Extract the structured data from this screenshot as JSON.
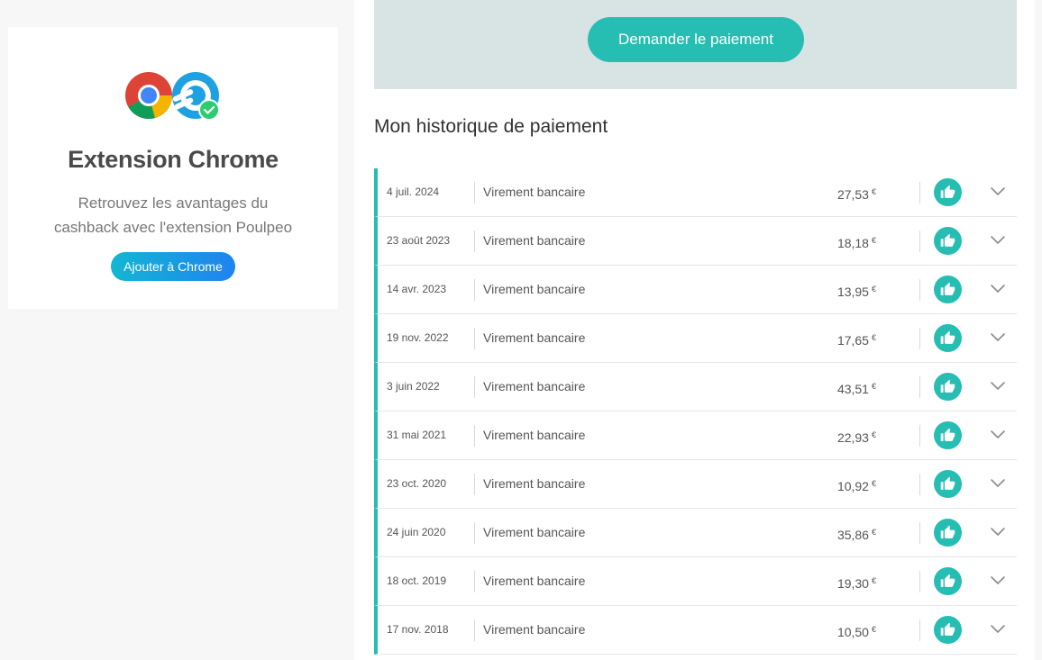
{
  "extension": {
    "title": "Extension Chrome",
    "description_line1": "Retrouvez les avantages du",
    "description_line2": "cashback avec l'extension Poulpeo",
    "button_label": "Ajouter à Chrome"
  },
  "payment": {
    "request_button_label": "Demander le paiement"
  },
  "history": {
    "title": "Mon historique de paiement",
    "currency": "€",
    "rows": [
      {
        "date": "4 juil. 2024",
        "method": "Virement bancaire",
        "amount": "27,53"
      },
      {
        "date": "23 août 2023",
        "method": "Virement bancaire",
        "amount": "18,18"
      },
      {
        "date": "14 avr. 2023",
        "method": "Virement bancaire",
        "amount": "13,95"
      },
      {
        "date": "19 nov. 2022",
        "method": "Virement bancaire",
        "amount": "17,65"
      },
      {
        "date": "3 juin 2022",
        "method": "Virement bancaire",
        "amount": "43,51"
      },
      {
        "date": "31 mai 2021",
        "method": "Virement bancaire",
        "amount": "22,93"
      },
      {
        "date": "23 oct. 2020",
        "method": "Virement bancaire",
        "amount": "10,92"
      },
      {
        "date": "24 juin 2020",
        "method": "Virement bancaire",
        "amount": "35,86"
      },
      {
        "date": "18 oct. 2019",
        "method": "Virement bancaire",
        "amount": "19,30"
      },
      {
        "date": "17 nov. 2018",
        "method": "Virement bancaire",
        "amount": "10,50"
      }
    ]
  },
  "icons": {
    "status": "thumbs-up-icon",
    "expand": "chevron-down-icon",
    "browser": "chrome-logo-icon",
    "brand": "poulpeo-logo-icon"
  },
  "colors": {
    "accent": "#26bdb3",
    "banner_bg": "#d8e3e3",
    "chrome_button_start": "#13b6d3",
    "chrome_button_end": "#1f83f0"
  }
}
